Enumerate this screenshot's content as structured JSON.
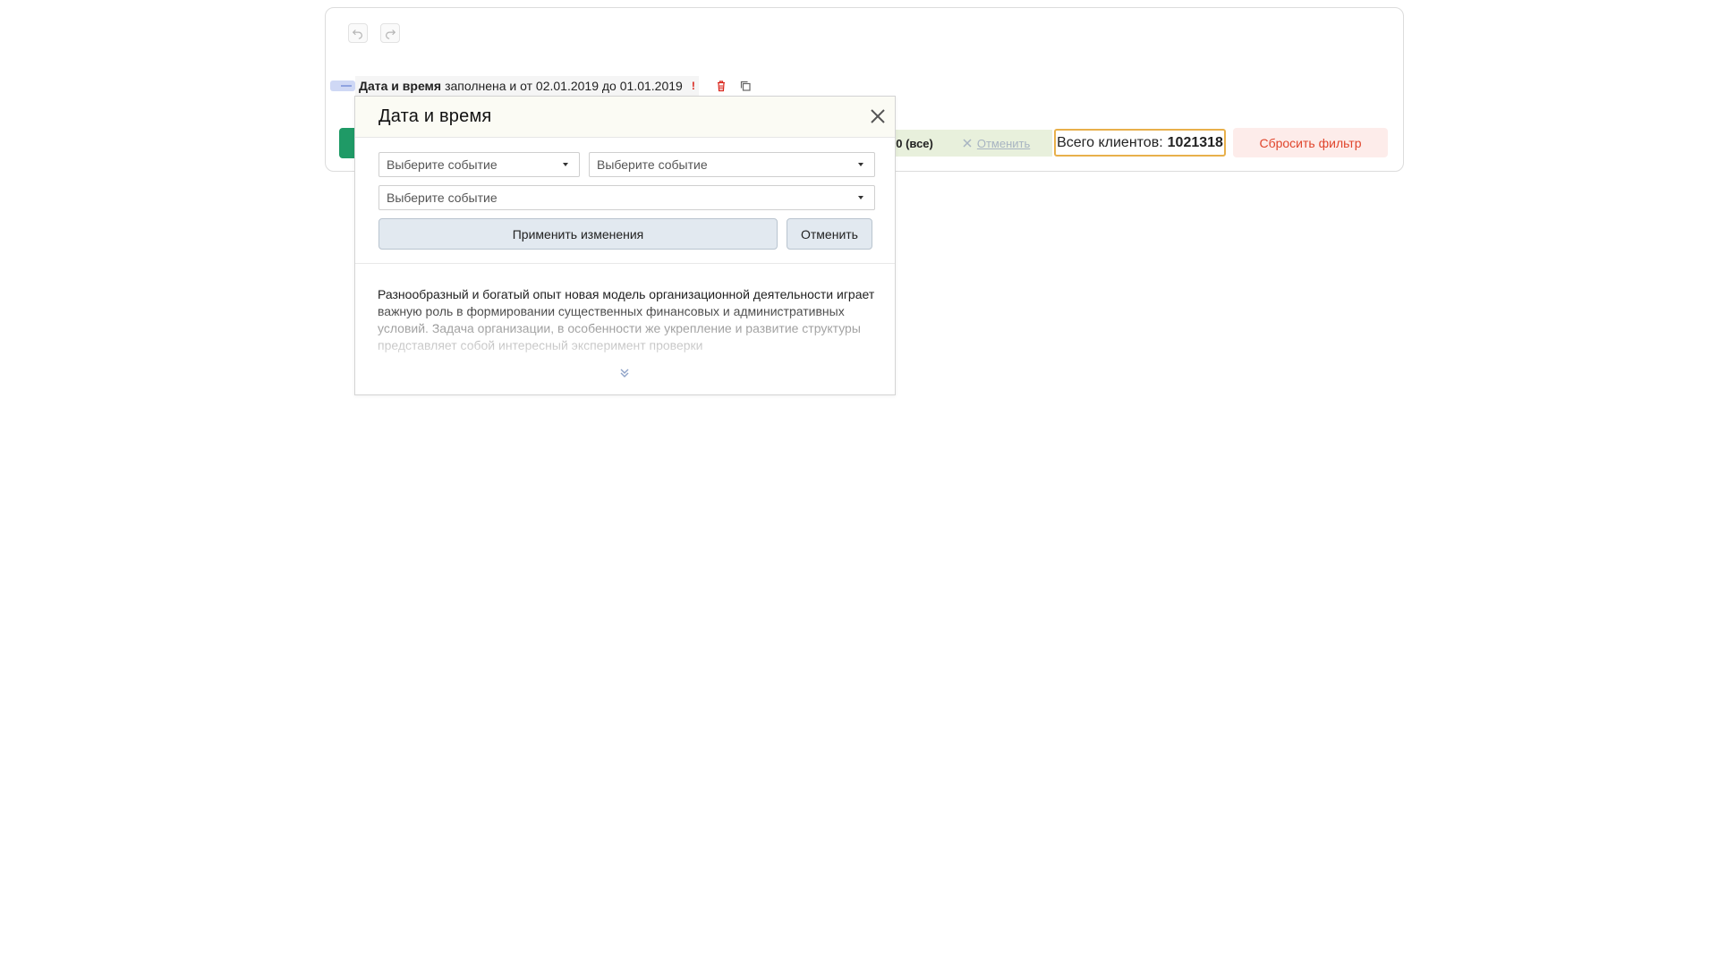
{
  "toolbar": {
    "undo_icon": "undo-icon",
    "redo_icon": "redo-icon"
  },
  "filter_row": {
    "field_name": "Дата и время",
    "condition_text": "заполнена и от 02.01.2019 до 01.01.2019",
    "warning_mark": "!",
    "delete_icon": "trash-icon",
    "copy_icon": "copy-icon"
  },
  "summary_bar": {
    "range_value": "00 (все)",
    "cancel_label": "Отменить",
    "total_label": "Всего клиентов:",
    "total_value": "1021318",
    "reset_label": "Сбросить фильтр"
  },
  "dialog": {
    "title": "Дата и время",
    "selects": [
      {
        "placeholder": "Выберите событие"
      },
      {
        "placeholder": "Выберите событие"
      },
      {
        "placeholder": "Выберите событие"
      }
    ],
    "apply_label": "Применить изменения",
    "cancel_label": "Отменить",
    "description": "Разнообразный и богатый опыт новая модель организационной деятельности играет важную роль в формировании существенных финансовых и административных условий. Задача организации, в особенности же укрепление и развитие структуры представляет собой интересный эксперимент проверки",
    "expand_icon": "double-chevron-down-icon"
  },
  "colors": {
    "accent_green": "#1f9a66",
    "warning_red": "#d9241b",
    "total_border": "#e8b04b",
    "reset_bg": "#fdecea",
    "reset_text": "#e0452c",
    "button_bg": "#e2e9f0"
  }
}
